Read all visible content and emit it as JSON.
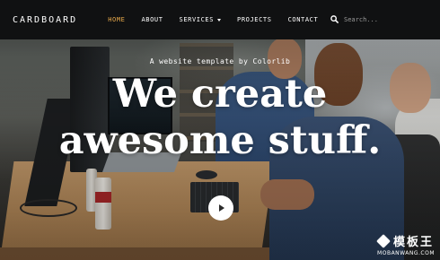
{
  "brand": {
    "name": "CARDBOARD"
  },
  "nav": {
    "items": [
      {
        "label": "HOME",
        "active": true
      },
      {
        "label": "ABOUT",
        "active": false
      },
      {
        "label": "SERVICES",
        "active": false,
        "dropdown": true
      },
      {
        "label": "PROJECTS",
        "active": false
      },
      {
        "label": "CONTACT",
        "active": false
      }
    ]
  },
  "search": {
    "placeholder": "Search...",
    "icon": "search-icon"
  },
  "hero": {
    "tagline": "A website template by Colorlib",
    "headline_line1": "We create",
    "headline_line2": "awesome stuff.",
    "play_icon": "play-icon"
  },
  "watermark": {
    "title": "模板王",
    "subtitle": "MOBANWANG.COM"
  },
  "colors": {
    "accent": "#e8a94a",
    "navbar": "#101112",
    "text": "#ffffff"
  }
}
